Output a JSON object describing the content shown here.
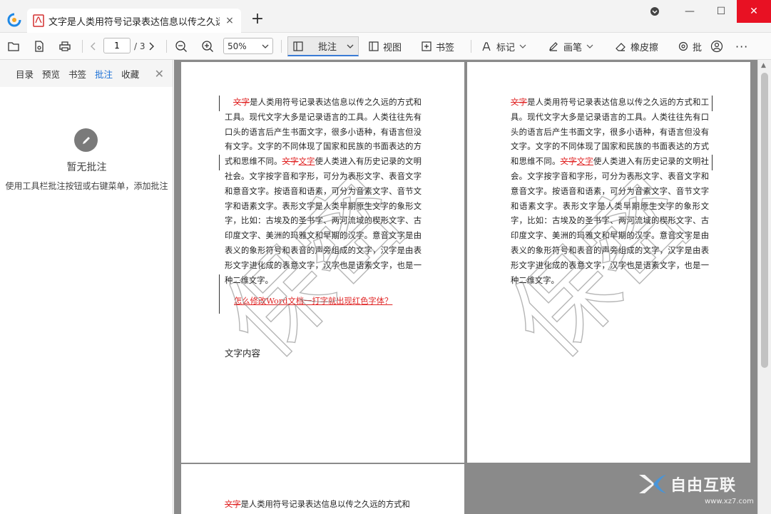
{
  "window": {
    "tab_title": "文字是人类用符号记录表达信息以传之久远...",
    "tab_close": "×",
    "new_tab": "+",
    "minimize": "—",
    "maximize": "☐",
    "close": "✕"
  },
  "toolbar": {
    "page_current": "1",
    "page_total": "/ 3",
    "zoom": "50%",
    "annotate_label": "批注",
    "view_label": "视图",
    "bookmark_label": "书签",
    "mark_label": "标记",
    "pen_label": "画笔",
    "eraser_label": "橡皮擦",
    "batch_label": "批",
    "more": "···"
  },
  "sidebar": {
    "tabs": [
      "目录",
      "预览",
      "书签",
      "批注",
      "收藏"
    ],
    "active_tab": "批注",
    "close": "✕",
    "empty_title": "暂无批注",
    "empty_hint": "使用工具栏批注按钮或右键菜单，添加批注"
  },
  "document": {
    "page1": {
      "struck": "文字",
      "text_a": "是人类用符号记录表达信息以传之久远的方式和工具。现代文字大多是记录语言的工具。人类往往先有口头的语言后产生书面文字，很多小语种，有语言但没有文字。文字的不同体现了国家和民族的书面表达的方式和思维不同。",
      "struck2": "文字",
      "inserted": "文字",
      "text_b": "使人类进入有历史记录的文明社会。文字按字音和字形，可分为表形文字、表音文字和意音文字。按语音和语素，可分为音素文字、音节文字和语素文字。表形文字是人类早期原生文字的象形文字，比如：古埃及的圣书字、两河流域的楔形文字、古印度文字、美洲的玛雅文和早期的汉字。意音文字是由表义的象形符号和表音的声旁组成的文字，汉字是由表形文字进化成的表意文字，汉字也是语素文字，也是一种二维文字。",
      "red_link": "怎么修改Word文档一打字就出现红色字体？",
      "content_label": "文字内容"
    },
    "page2": {
      "struck": "文字",
      "text_a": "是人类用符号记录表达信息以传之久远的方式和工具。现代文字大多是记录语言的工具。人类往往先有口头的语言后产生书面文字，很多小语种，有语言但没有文字。文字的不同体现了国家和民族的书面表达的方式和思维不同。",
      "struck2": "文字",
      "inserted": "文字",
      "text_b": "使人类进入有历史记录的文明社会。文字按字音和字形，可分为表形文字、表音文字和意音文字。按语音和语素，可分为音素文字、音节文字和语素文字。表形文字是人类早期原生文字的象形文字，比如：古埃及的圣书字、两河流域的楔形文字、古印度文字、美洲的玛雅文和早期的汉字。意音文字是由表义的象形符号和表音的声旁组成的文字，汉字是由表形文字进化成的表意文字，汉字也是语素文字，也是一种二维文字。"
    },
    "page3": {
      "struck": "文字",
      "text_a": "是人类用符号记录表达信息以传之久远的方式和"
    },
    "watermark": "保密"
  },
  "brand": {
    "name": "自由互联",
    "url": "www.xz7.com"
  },
  "colors": {
    "accent": "#1a6fd6",
    "revision_red": "#e02424",
    "close_red": "#e81123"
  }
}
